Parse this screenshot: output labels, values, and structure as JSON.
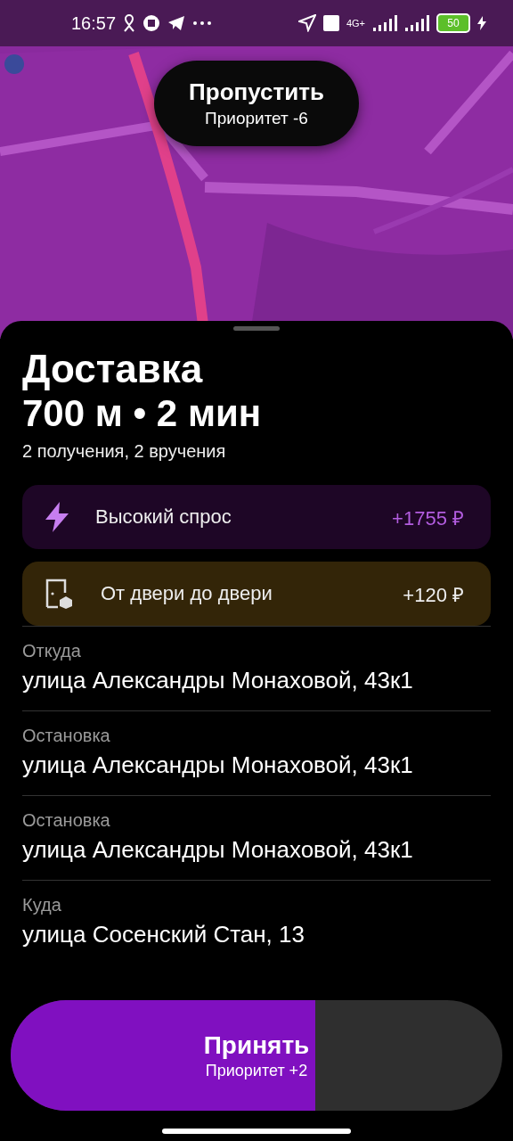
{
  "status_bar": {
    "time": "16:57",
    "network": "4G+",
    "battery": "50"
  },
  "skip_button": {
    "label": "Пропустить",
    "subtitle": "Приоритет -6"
  },
  "order": {
    "title": "Доставка",
    "summary": "700 м • 2 мин",
    "details": "2 получения, 2 вручения"
  },
  "bonuses": [
    {
      "kind": "demand",
      "label": "Высокий спрос",
      "amount": "+1755 ₽"
    },
    {
      "kind": "door",
      "label": "От двери до двери",
      "amount": "+120 ₽"
    }
  ],
  "route": [
    {
      "label": "Откуда",
      "address": "улица Александры Монаховой, 43к1"
    },
    {
      "label": "Остановка",
      "address": "улица Александры Монаховой, 43к1"
    },
    {
      "label": "Остановка",
      "address": "улица Александры Монаховой, 43к1"
    },
    {
      "label": "Куда",
      "address": "улица Сосенский Стан, 13"
    }
  ],
  "accept_button": {
    "label": "Принять",
    "subtitle": "Приоритет +2",
    "level": 0.62
  }
}
